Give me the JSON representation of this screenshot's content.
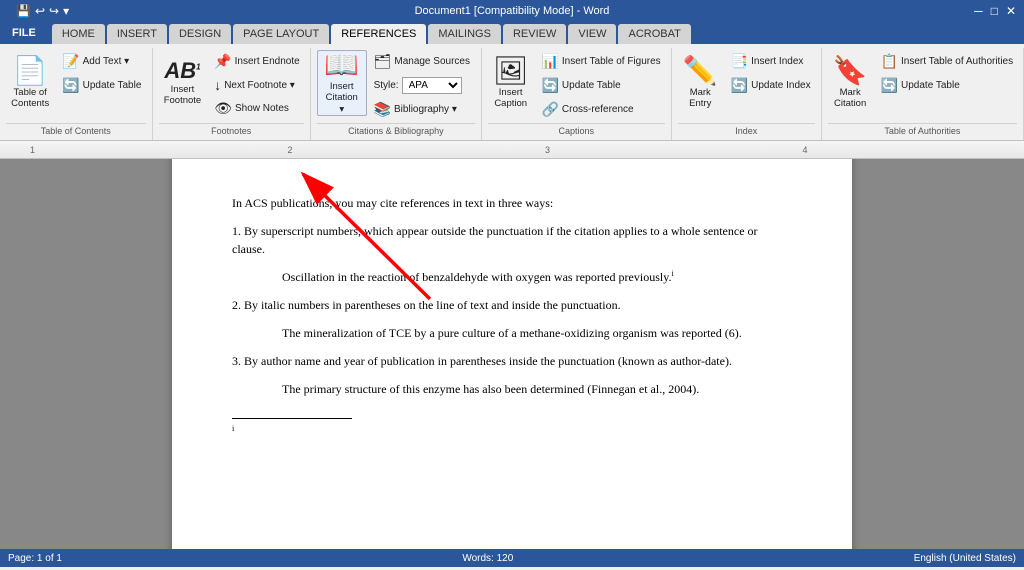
{
  "window": {
    "title": "Document1 [Compatibility Mode] - Word",
    "file_btn": "FILE"
  },
  "tabs": [
    {
      "id": "home",
      "label": "HOME",
      "active": false
    },
    {
      "id": "insert",
      "label": "INSERT",
      "active": false
    },
    {
      "id": "design",
      "label": "DESIGN",
      "active": false
    },
    {
      "id": "page-layout",
      "label": "PAGE LAYOUT",
      "active": false
    },
    {
      "id": "references",
      "label": "REFERENCES",
      "active": true
    },
    {
      "id": "mailings",
      "label": "MAILINGS",
      "active": false
    },
    {
      "id": "review",
      "label": "REVIEW",
      "active": false
    },
    {
      "id": "view",
      "label": "VIEW",
      "active": false
    },
    {
      "id": "acrobat",
      "label": "ACROBAT",
      "active": false
    }
  ],
  "ribbon": {
    "groups": [
      {
        "id": "table-of-contents",
        "label": "Table of Contents",
        "items": [
          {
            "id": "table-of-contents-btn",
            "icon": "📄",
            "label": "Table of\nContents",
            "large": true
          }
        ],
        "small_items": [
          {
            "id": "add-text-btn",
            "icon": "📝",
            "label": "Add Text ▾"
          },
          {
            "id": "update-table-btn",
            "icon": "🔄",
            "label": "Update Table"
          }
        ]
      },
      {
        "id": "footnotes",
        "label": "Footnotes",
        "items": [
          {
            "id": "insert-footnote-btn",
            "icon": "AB¹",
            "label": "Insert\nFootnote",
            "large": true
          }
        ],
        "small_items": [
          {
            "id": "insert-endnote-btn",
            "icon": "📌",
            "label": "Insert Endnote"
          },
          {
            "id": "next-footnote-btn",
            "icon": "→",
            "label": "Next Footnote ▾"
          },
          {
            "id": "show-notes-btn",
            "icon": "👁",
            "label": "Show Notes"
          }
        ]
      },
      {
        "id": "citations",
        "label": "Citations & Bibliography",
        "items": [
          {
            "id": "insert-citation-btn",
            "icon": "📖",
            "label": "Insert\nCitation ▾",
            "large": true
          }
        ],
        "small_items": [
          {
            "id": "manage-sources-btn",
            "icon": "🗂",
            "label": "Manage Sources"
          },
          {
            "id": "style-label",
            "label": "Style:"
          },
          {
            "id": "style-select",
            "type": "select",
            "value": "APA"
          },
          {
            "id": "bibliography-btn",
            "icon": "📚",
            "label": "Bibliography ▾"
          }
        ]
      },
      {
        "id": "captions",
        "label": "Captions",
        "items": [
          {
            "id": "insert-caption-btn",
            "icon": "🖼",
            "label": "Insert\nCaption",
            "large": true
          }
        ],
        "small_items": [
          {
            "id": "insert-table-figures-btn",
            "icon": "📊",
            "label": "Insert Table of Figures"
          },
          {
            "id": "update-table2-btn",
            "icon": "🔄",
            "label": "Update Table"
          },
          {
            "id": "cross-reference-btn",
            "icon": "🔗",
            "label": "Cross-reference"
          }
        ]
      },
      {
        "id": "index",
        "label": "Index",
        "items": [
          {
            "id": "mark-entry-btn",
            "icon": "✏️",
            "label": "Mark\nEntry",
            "large": true
          }
        ],
        "small_items": [
          {
            "id": "insert-index-btn",
            "icon": "📑",
            "label": "Insert Index"
          },
          {
            "id": "update-index-btn",
            "icon": "🔄",
            "label": "Update Index"
          }
        ]
      },
      {
        "id": "table-of-authorities",
        "label": "Table of Authorities",
        "items": [
          {
            "id": "mark-citation-btn",
            "icon": "🔖",
            "label": "Mark\nCitation",
            "large": true
          }
        ],
        "small_items": [
          {
            "id": "insert-table-authorities-btn",
            "icon": "📋",
            "label": "Insert Table of Authorities"
          },
          {
            "id": "update-table3-btn",
            "icon": "🔄",
            "label": "Update Table"
          }
        ]
      }
    ]
  },
  "document": {
    "paragraphs": [
      {
        "id": "p1",
        "text": "In ACS publications, you may cite references in text in three ways:",
        "indent": false
      },
      {
        "id": "p2",
        "text": "1. By superscript numbers, which appear outside the punctuation if the citation applies to a whole sentence or clause.",
        "indent": false
      },
      {
        "id": "p3",
        "text": "Oscillation in the reaction of benzaldehyde with oxygen was reported previously.",
        "superscript": "i",
        "indent": true
      },
      {
        "id": "p4",
        "text": "2. By italic numbers in parentheses on the line of text and inside the punctuation.",
        "indent": false
      },
      {
        "id": "p5",
        "text": "The mineralization of TCE by a pure culture of a methane-oxidizing organism was reported (6).",
        "indent": true
      },
      {
        "id": "p6",
        "text": "3. By author name and year of publication in parentheses inside the punctuation (known as author-date).",
        "indent": false
      },
      {
        "id": "p7",
        "text": "The primary structure of this enzyme has also been determined (Finnegan et al., 2004).",
        "indent": true
      }
    ],
    "footnote_marker": "i"
  },
  "status_bar": {
    "left": "Page: 1 of 1",
    "words": "Words: 120",
    "language": "English (United States)"
  },
  "arrow": {
    "visible": true
  }
}
